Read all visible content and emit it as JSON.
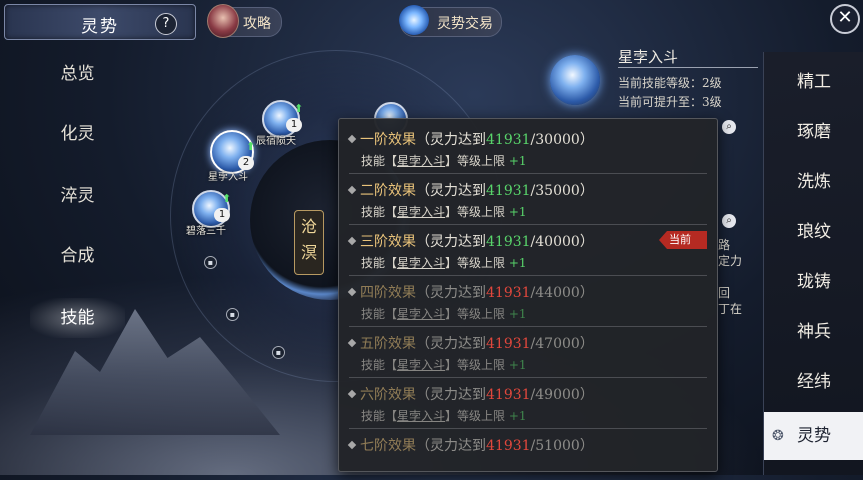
{
  "header": {
    "title": "灵势",
    "help_label": "?",
    "guide_label": "攻略",
    "trade_label": "灵势交易",
    "close_label": "✕"
  },
  "left_menu": [
    {
      "label": "总览"
    },
    {
      "label": "化灵"
    },
    {
      "label": "淬灵"
    },
    {
      "label": "合成"
    },
    {
      "label": "技能",
      "active": true
    }
  ],
  "right_menu": [
    {
      "label": "精工"
    },
    {
      "label": "琢磨"
    },
    {
      "label": "洗炼"
    },
    {
      "label": "琅纹"
    },
    {
      "label": "珑铸"
    },
    {
      "label": "神兵"
    },
    {
      "label": "经纬"
    },
    {
      "label": "灵势",
      "active": true
    }
  ],
  "wheel": {
    "center_label": "沧溟",
    "nodes": [
      {
        "name": "辰宿陨天",
        "level": "1"
      },
      {
        "name": "星孛入斗",
        "level": "2"
      },
      {
        "name": "碧落三千",
        "level": "1"
      }
    ]
  },
  "skill_info": {
    "name": "星孛入斗",
    "current_level": "当前技能等级：2级",
    "upgradable": "当前可提升至：3级",
    "frag_1": "路",
    "frag_2": "定力",
    "frag_3": "回",
    "frag_4": "丁在"
  },
  "tooltip": {
    "tiers": [
      {
        "name": "一阶效果",
        "prefix": "（灵力达到",
        "current": "41931",
        "target": "/30000",
        "suffix": "）",
        "sub_prefix": "技能【",
        "skill": "星孛入斗",
        "sub_suffix": "】等级上限",
        "bonus": "+1",
        "reached": true
      },
      {
        "name": "二阶效果",
        "prefix": "（灵力达到",
        "current": "41931",
        "target": "/35000",
        "suffix": "）",
        "sub_prefix": "技能【",
        "skill": "星孛入斗",
        "sub_suffix": "】等级上限",
        "bonus": "+1",
        "reached": true
      },
      {
        "name": "三阶效果",
        "prefix": "（灵力达到",
        "current": "41931",
        "target": "/40000",
        "suffix": "）",
        "sub_prefix": "技能【",
        "skill": "星孛入斗",
        "sub_suffix": "】等级上限",
        "bonus": "+1",
        "reached": true,
        "tag": "当前激活"
      },
      {
        "name": "四阶效果",
        "prefix": "（灵力达到",
        "current": "41931",
        "target": "/44000",
        "suffix": "）",
        "sub_prefix": "技能【",
        "skill": "星孛入斗",
        "sub_suffix": "】等级上限",
        "bonus": "+1",
        "reached": false
      },
      {
        "name": "五阶效果",
        "prefix": "（灵力达到",
        "current": "41931",
        "target": "/47000",
        "suffix": "）",
        "sub_prefix": "技能【",
        "skill": "星孛入斗",
        "sub_suffix": "】等级上限",
        "bonus": "+1",
        "reached": false
      },
      {
        "name": "六阶效果",
        "prefix": "（灵力达到",
        "current": "41931",
        "target": "/49000",
        "suffix": "）",
        "sub_prefix": "技能【",
        "skill": "星孛入斗",
        "sub_suffix": "】等级上限",
        "bonus": "+1",
        "reached": false
      },
      {
        "name": "七阶效果",
        "prefix": "（灵力达到",
        "current": "41931",
        "target": "/51000",
        "suffix": "）",
        "reached": false
      }
    ]
  },
  "colors": {
    "reached": "#58d36a",
    "unreached": "#e0473c",
    "tier_name": "#e9c37a",
    "active_tag": "#b52a22"
  }
}
